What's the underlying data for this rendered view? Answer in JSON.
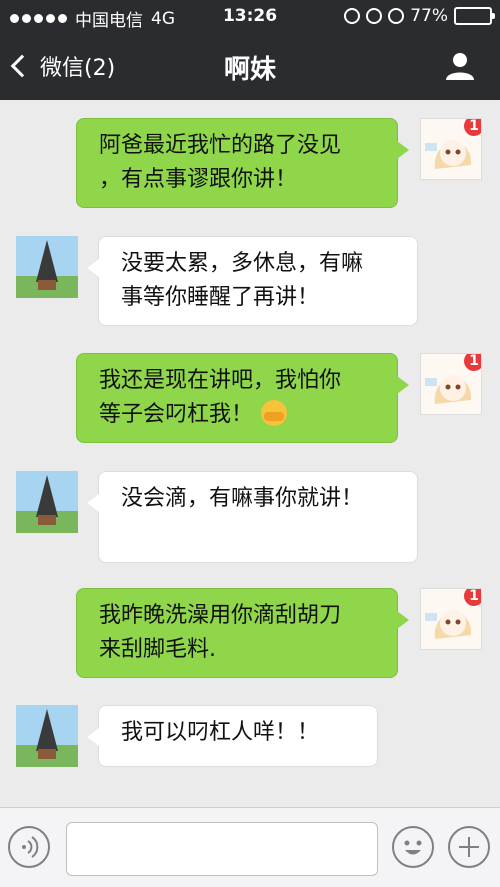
{
  "status_bar": {
    "carrier": "中国电信",
    "network": "4G",
    "time": "13:26",
    "battery_percent_label": "77%",
    "battery_level": 0.77
  },
  "nav": {
    "back_label": "微信(2)",
    "title": "啊妹"
  },
  "messages": [
    {
      "from": "me",
      "text_lines": [
        "阿爸最近我忙的路了没见",
        "，有点事谬跟你讲！"
      ],
      "badge": "1"
    },
    {
      "from": "them",
      "text_lines": [
        "没要太累，多休息，有嘛",
        "事等你睡醒了再讲！"
      ]
    },
    {
      "from": "me",
      "text_lines": [
        "我还是现在讲吧，我怕你",
        "等子会叼杠我！"
      ],
      "badge": "1",
      "has_emoji": true
    },
    {
      "from": "them",
      "text_lines": [
        "没会滴，有嘛事你就讲！"
      ]
    },
    {
      "from": "me",
      "text_lines": [
        "我昨晚洗澡用你滴刮胡刀",
        "来刮脚毛料."
      ],
      "badge": "1"
    },
    {
      "from": "them",
      "text_lines": [
        "我可以叼杠人咩！！"
      ]
    }
  ],
  "colors": {
    "topbar": "#2b2c30",
    "chat_bg": "#ebebeb",
    "my_bubble": "#8fd64a",
    "their_bubble": "#ffffff",
    "badge": "#e83a3a"
  },
  "icons": {
    "back": "chevron-left-icon",
    "profile": "user-icon",
    "voice": "voice-icon",
    "emoji": "smiley-icon",
    "more": "plus-icon"
  }
}
